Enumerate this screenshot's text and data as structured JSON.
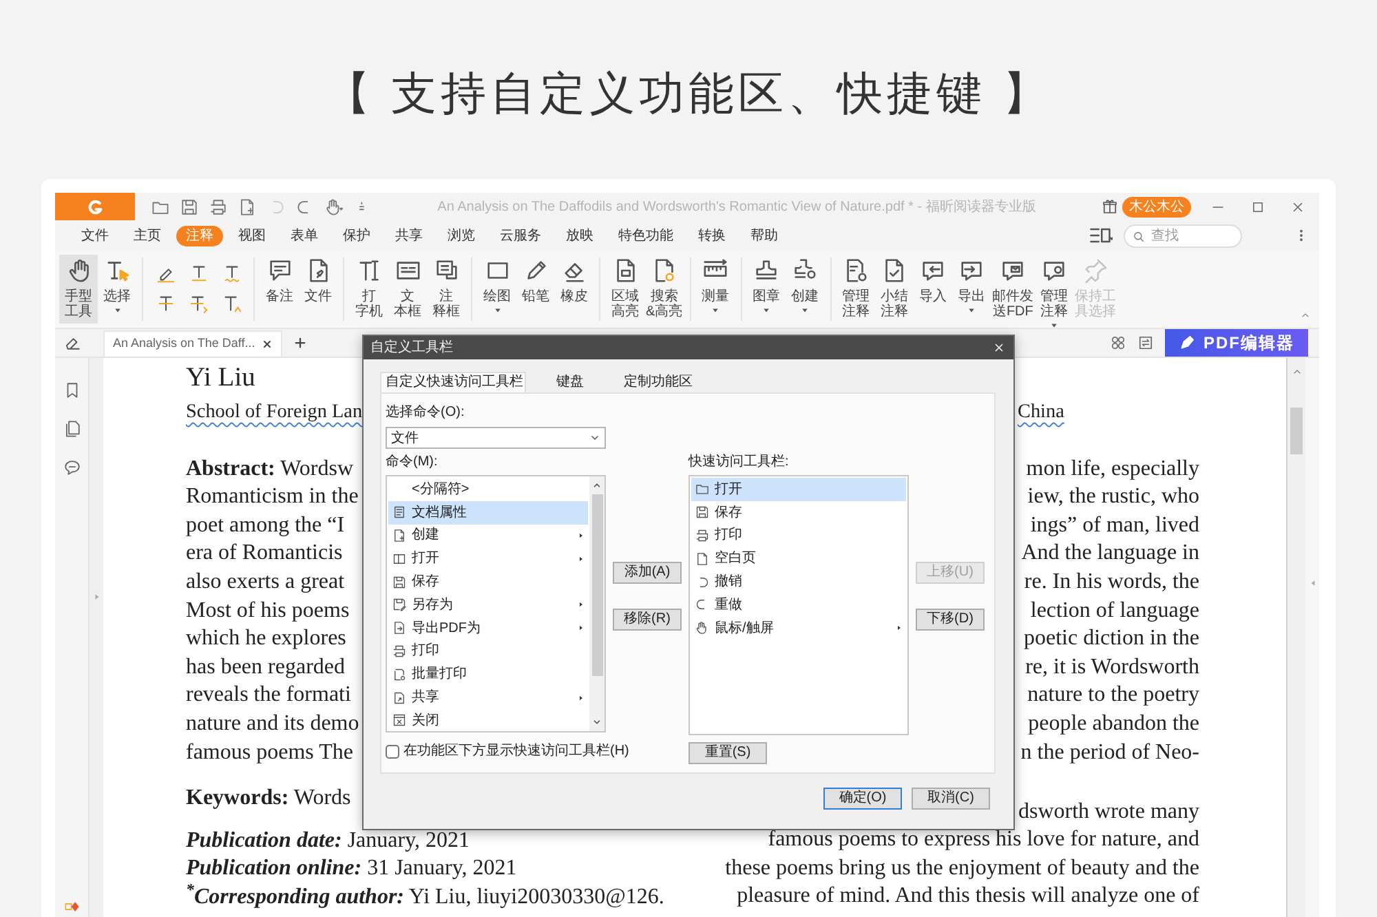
{
  "heading": "【 支持自定义功能区、快捷键 】",
  "window": {
    "title": "An Analysis on The Daffodils and Wordsworth's Romantic View of Nature.pdf * - 福昕阅读器专业版",
    "user": "木公木公"
  },
  "menu": [
    {
      "label": "文件",
      "selected": false
    },
    {
      "label": "主页",
      "selected": false
    },
    {
      "label": "注释",
      "selected": true
    },
    {
      "label": "视图",
      "selected": false
    },
    {
      "label": "表单",
      "selected": false
    },
    {
      "label": "保护",
      "selected": false
    },
    {
      "label": "共享",
      "selected": false
    },
    {
      "label": "浏览",
      "selected": false
    },
    {
      "label": "云服务",
      "selected": false
    },
    {
      "label": "放映",
      "selected": false
    },
    {
      "label": "特色功能",
      "selected": false
    },
    {
      "label": "转换",
      "selected": false
    },
    {
      "label": "帮助",
      "selected": false
    }
  ],
  "search": {
    "placeholder": "查找"
  },
  "ribbon": [
    {
      "kind": "tools",
      "items": [
        {
          "label": [
            "手型",
            "工具"
          ],
          "selected": true,
          "dropdown": false,
          "disabled": false
        },
        {
          "label": [
            "选择"
          ],
          "selected": false,
          "dropdown": true,
          "disabled": false
        }
      ]
    },
    {
      "kind": "markup"
    },
    {
      "kind": "tools",
      "items": [
        {
          "label": [
            "备注"
          ],
          "selected": false,
          "dropdown": false,
          "disabled": false
        },
        {
          "label": [
            "文件"
          ],
          "selected": false,
          "dropdown": false,
          "disabled": false
        }
      ]
    },
    {
      "kind": "tools",
      "items": [
        {
          "label": [
            "打",
            "字机"
          ],
          "selected": false,
          "dropdown": false,
          "disabled": false
        },
        {
          "label": [
            "文",
            "本框"
          ],
          "selected": false,
          "dropdown": false,
          "disabled": false
        },
        {
          "label": [
            "注",
            "释框"
          ],
          "selected": false,
          "dropdown": false,
          "disabled": false
        }
      ]
    },
    {
      "kind": "tools",
      "items": [
        {
          "label": [
            "绘图"
          ],
          "selected": false,
          "dropdown": true,
          "disabled": false
        },
        {
          "label": [
            "铅笔"
          ],
          "selected": false,
          "dropdown": false,
          "disabled": false
        },
        {
          "label": [
            "橡皮"
          ],
          "selected": false,
          "dropdown": false,
          "disabled": false
        }
      ]
    },
    {
      "kind": "tools",
      "items": [
        {
          "label": [
            "区域",
            "高亮"
          ],
          "selected": false,
          "dropdown": false,
          "disabled": false
        },
        {
          "label": [
            "搜索",
            "&高亮"
          ],
          "selected": false,
          "dropdown": false,
          "disabled": false
        }
      ]
    },
    {
      "kind": "tools",
      "items": [
        {
          "label": [
            "测量"
          ],
          "selected": false,
          "dropdown": true,
          "disabled": false
        }
      ]
    },
    {
      "kind": "tools",
      "items": [
        {
          "label": [
            "图章"
          ],
          "selected": false,
          "dropdown": true,
          "disabled": false
        },
        {
          "label": [
            "创建"
          ],
          "selected": false,
          "dropdown": true,
          "disabled": false
        }
      ]
    },
    {
      "kind": "tools",
      "items": [
        {
          "label": [
            "管理",
            "注释"
          ],
          "selected": false,
          "dropdown": false,
          "disabled": false
        },
        {
          "label": [
            "小结",
            "注释"
          ],
          "selected": false,
          "dropdown": false,
          "disabled": false
        },
        {
          "label": [
            "导入"
          ],
          "selected": false,
          "dropdown": false,
          "disabled": false
        },
        {
          "label": [
            "导出"
          ],
          "selected": false,
          "dropdown": true,
          "disabled": false
        },
        {
          "label": [
            "邮件发",
            "送FDF"
          ],
          "selected": false,
          "dropdown": false,
          "disabled": false
        },
        {
          "label": [
            "管理",
            "注释"
          ],
          "selected": false,
          "dropdown": true,
          "disabled": false
        },
        {
          "label": [
            "保持工",
            "具选择"
          ],
          "selected": false,
          "dropdown": false,
          "disabled": true
        }
      ]
    }
  ],
  "document_tab": {
    "label": "An Analysis on The Daff..."
  },
  "editor_button": "PDF编辑器",
  "document": {
    "paragraphs": [
      {
        "kind": "author",
        "lines": [
          {
            "left": "Yi Liu",
            "misspelled": false
          }
        ]
      },
      {
        "kind": "affiliation",
        "lines": [
          {
            "left": "School of Foreign Lan",
            "right": "China",
            "misspelled": true
          }
        ]
      },
      {
        "kind": "justified",
        "lines": [
          {
            "left": "**Abstract:** Wordsw",
            "right": "mon life, especially",
            "misspelled": false
          },
          {
            "left": "Romanticism in the",
            "right": "iew, the rustic, who",
            "misspelled": false
          },
          {
            "left": "poet among the “I",
            "right": "ings” of man, lived",
            "misspelled": false
          },
          {
            "left": "era of Romanticis",
            "right": "And the language in",
            "misspelled": false
          },
          {
            "left": "also exerts a great",
            "right": "re. In his words, the",
            "misspelled": false
          },
          {
            "left": "Most of his poems",
            "right": "lection of language",
            "misspelled": false
          },
          {
            "left": "which he explores",
            "right": "poetic diction in the",
            "misspelled": false
          },
          {
            "left": "has been regarded",
            "right": "re, it is Wordsworth",
            "misspelled": false
          },
          {
            "left": "reveals the formati",
            "right": "nature to the poetry",
            "misspelled": false
          },
          {
            "left": "nature and its demo",
            "right": "people abandon the",
            "misspelled": false
          },
          {
            "left": "famous poems The",
            "right": "n the period of Neo-",
            "misspelled": false
          }
        ]
      }
    ],
    "columns": [
      {
        "paragraphs": [
          {
            "lines": [
              {
                "text": "**Keywords:** Words"
              }
            ]
          },
          {
            "lines": [
              {
                "label": "Publication date:",
                "text": "January, 2021"
              },
              {
                "label": "Publication online:",
                "text": "31 January, 2021"
              },
              {
                "label": "$^{*}$Corresponding author:",
                "text": "Yi Liu, liuyi20030330@126."
              }
            ]
          }
        ]
      },
      {
        "paragraphs": [
          {
            "lines": [
              {
                "text": "dsworth wrote many"
              },
              {
                "text": "famous poems to express his love for nature, and"
              },
              {
                "text": "these poems bring us the enjoyment of beauty and the"
              },
              {
                "text": "pleasure of mind. And this thesis will analyze one of"
              }
            ]
          }
        ]
      }
    ]
  },
  "dialog": {
    "title": "自定义工具栏",
    "tabs": [
      {
        "label": "自定义快速访问工具栏",
        "selected": true
      },
      {
        "label": "键盘",
        "selected": false
      },
      {
        "label": "定制功能区",
        "selected": false
      }
    ],
    "command_source": {
      "label": "选择命令(O):",
      "value": "文件"
    },
    "commands": {
      "label": "命令(M):",
      "items": [
        {
          "kind": "separator",
          "label": "<分隔符>",
          "selected": false,
          "submenu": false
        },
        {
          "kind": "command",
          "label": "文档属性",
          "selected": true,
          "submenu": false
        },
        {
          "kind": "command",
          "label": "创建",
          "selected": false,
          "submenu": true
        },
        {
          "kind": "command",
          "label": "打开",
          "selected": false,
          "submenu": true
        },
        {
          "kind": "command",
          "label": "保存",
          "selected": false,
          "submenu": false
        },
        {
          "kind": "command",
          "label": "另存为",
          "selected": false,
          "submenu": true
        },
        {
          "kind": "command",
          "label": "导出PDF为",
          "selected": false,
          "submenu": true
        },
        {
          "kind": "command",
          "label": "打印",
          "selected": false,
          "submenu": false
        },
        {
          "kind": "command",
          "label": "批量打印",
          "selected": false,
          "submenu": false
        },
        {
          "kind": "command",
          "label": "共享",
          "selected": false,
          "submenu": true
        },
        {
          "kind": "command",
          "label": "关闭",
          "selected": false,
          "submenu": false
        }
      ]
    },
    "middle_buttons": [
      {
        "label": "添加(A)",
        "disabled": false
      },
      {
        "label": "移除(R)",
        "disabled": false
      }
    ],
    "quick_access": {
      "label": "快速访问工具栏:",
      "items": [
        {
          "label": "打开",
          "selected": true,
          "submenu": false
        },
        {
          "label": "保存",
          "selected": false,
          "submenu": false
        },
        {
          "label": "打印",
          "selected": false,
          "submenu": false
        },
        {
          "label": "空白页",
          "selected": false,
          "submenu": false
        },
        {
          "label": "撤销",
          "selected": false,
          "submenu": false
        },
        {
          "label": "重做",
          "selected": false,
          "submenu": false
        },
        {
          "label": "鼠标/触屏",
          "selected": false,
          "submenu": true
        }
      ]
    },
    "order_buttons": [
      {
        "label": "上移(U)",
        "disabled": true
      },
      {
        "label": "下移(D)",
        "disabled": false
      }
    ],
    "reset_button": "重置(S)",
    "checkbox": {
      "label": "在功能区下方显示快速访问工具栏(H)",
      "checked": false
    },
    "footer_buttons": [
      {
        "label": "确定(O)",
        "default": true
      },
      {
        "label": "取消(C)",
        "default": false
      }
    ]
  }
}
